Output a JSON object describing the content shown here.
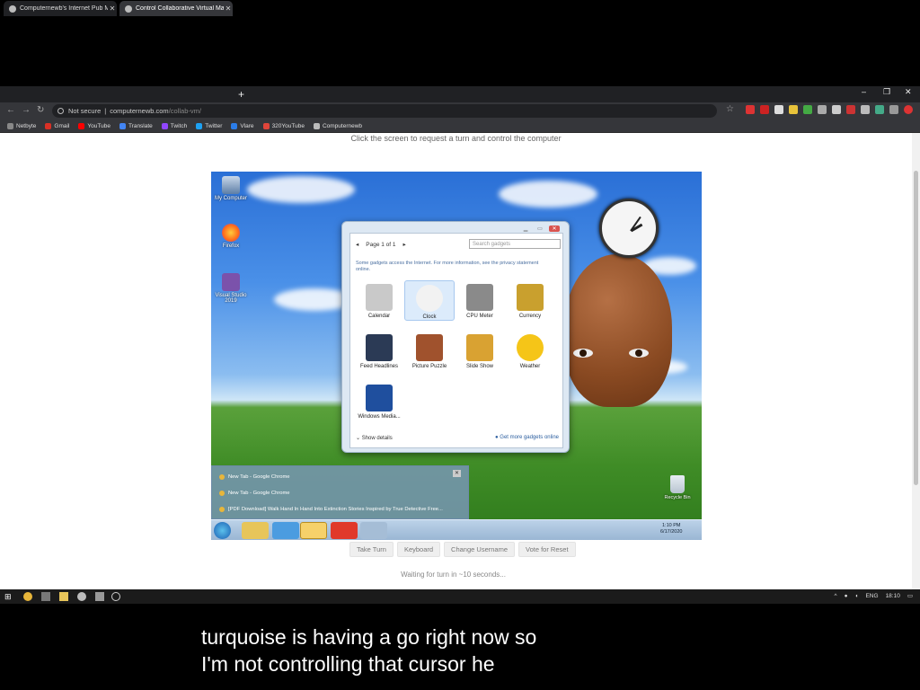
{
  "browser": {
    "tabs": [
      {
        "label": "Computernewb's Internet Pub M",
        "active": false
      },
      {
        "label": "Control Collaborative Virtual Ma",
        "active": true
      }
    ],
    "new_tab": "+",
    "window_controls": [
      "–",
      "❐",
      "✕"
    ],
    "security_label": "Not secure",
    "url_host": "computernewb.com",
    "url_path": "/collab-vm/",
    "bookmarks": [
      "Netbyte",
      "Gmail",
      "YouTube",
      "Translate",
      "Twitch",
      "Twitter",
      "Vlare",
      "320YouTube",
      "Computernewb"
    ],
    "bookmark_colors": [
      "#888888",
      "#d93025",
      "#ff0000",
      "#4285f4",
      "#9146ff",
      "#1da1f2",
      "#2b7de9",
      "#e0453a",
      "#bbbbbb"
    ]
  },
  "page": {
    "instruction": "Click the screen to request a turn and control the computer",
    "buttons": [
      "Take Turn",
      "Keyboard",
      "Change Username",
      "Vote for Reset"
    ],
    "waiting": "Waiting for turn in ~10 seconds..."
  },
  "vm": {
    "desktop_icons": [
      "My Computer",
      "Firefox",
      "Visual Studio 2019"
    ],
    "recycle_bin": "Recycle Bin",
    "clock_time": "1:10 PM",
    "clock_date": "6/17/2020",
    "gadgets_dialog": {
      "pager": "Page 1 of 1",
      "search_placeholder": "Search gadgets",
      "notice": "Some gadgets access the Internet. For more information, see the privacy statement online.",
      "gadgets": [
        {
          "label": "Calendar",
          "color": "#c9c9c9"
        },
        {
          "label": "Clock",
          "color": "#f2f2f2"
        },
        {
          "label": "CPU Meter",
          "color": "#8a8a8a"
        },
        {
          "label": "Currency",
          "color": "#c9a02e"
        },
        {
          "label": "Feed Headlines",
          "color": "#2b3a55"
        },
        {
          "label": "Picture Puzzle",
          "color": "#a0522d"
        },
        {
          "label": "Slide Show",
          "color": "#d9a232"
        },
        {
          "label": "Weather",
          "color": "#f5c518"
        },
        {
          "label": "Windows Media...",
          "color": "#1f4f9e"
        }
      ],
      "show_details": "Show details",
      "get_more": "Get more gadgets online"
    },
    "jumplist": [
      "New Tab - Google Chrome",
      "New Tab - Google Chrome",
      "[PDF Download] Walk Hand In Hand Into Extinction Stories Inspired by True Detective Free..."
    ]
  },
  "host": {
    "tray_lang": "ENG",
    "tray_time": "18:10"
  },
  "caption": {
    "line1": "turquoise is having a go right now so",
    "line2": "I'm not controlling that cursor he"
  }
}
